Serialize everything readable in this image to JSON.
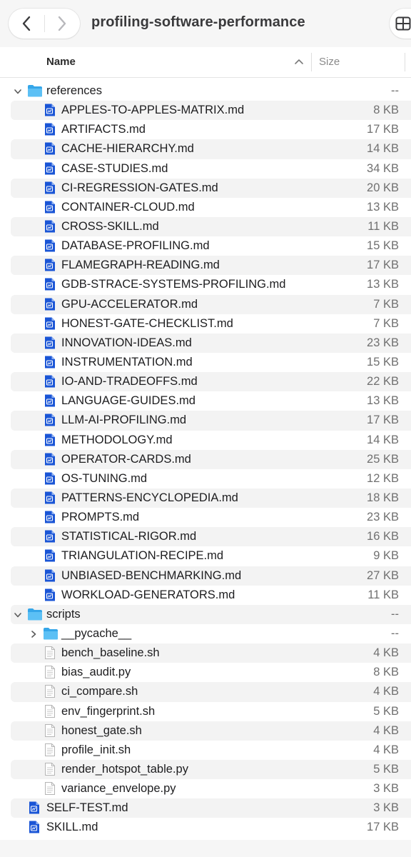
{
  "window": {
    "title": "profiling-software-performance"
  },
  "columns": {
    "name": "Name",
    "size": "Size"
  },
  "rows": [
    {
      "name": "references",
      "size": "--",
      "kind": "folder",
      "depth": 0,
      "expanded": true
    },
    {
      "name": "APPLES-TO-APPLES-MATRIX.md",
      "size": "8 KB",
      "kind": "md",
      "depth": 1
    },
    {
      "name": "ARTIFACTS.md",
      "size": "17 KB",
      "kind": "md",
      "depth": 1
    },
    {
      "name": "CACHE-HIERARCHY.md",
      "size": "14 KB",
      "kind": "md",
      "depth": 1
    },
    {
      "name": "CASE-STUDIES.md",
      "size": "34 KB",
      "kind": "md",
      "depth": 1
    },
    {
      "name": "CI-REGRESSION-GATES.md",
      "size": "20 KB",
      "kind": "md",
      "depth": 1
    },
    {
      "name": "CONTAINER-CLOUD.md",
      "size": "13 KB",
      "kind": "md",
      "depth": 1
    },
    {
      "name": "CROSS-SKILL.md",
      "size": "11 KB",
      "kind": "md",
      "depth": 1
    },
    {
      "name": "DATABASE-PROFILING.md",
      "size": "15 KB",
      "kind": "md",
      "depth": 1
    },
    {
      "name": "FLAMEGRAPH-READING.md",
      "size": "17 KB",
      "kind": "md",
      "depth": 1
    },
    {
      "name": "GDB-STRACE-SYSTEMS-PROFILING.md",
      "size": "13 KB",
      "kind": "md",
      "depth": 1
    },
    {
      "name": "GPU-ACCELERATOR.md",
      "size": "7 KB",
      "kind": "md",
      "depth": 1
    },
    {
      "name": "HONEST-GATE-CHECKLIST.md",
      "size": "7 KB",
      "kind": "md",
      "depth": 1
    },
    {
      "name": "INNOVATION-IDEAS.md",
      "size": "23 KB",
      "kind": "md",
      "depth": 1
    },
    {
      "name": "INSTRUMENTATION.md",
      "size": "15 KB",
      "kind": "md",
      "depth": 1
    },
    {
      "name": "IO-AND-TRADEOFFS.md",
      "size": "22 KB",
      "kind": "md",
      "depth": 1
    },
    {
      "name": "LANGUAGE-GUIDES.md",
      "size": "13 KB",
      "kind": "md",
      "depth": 1
    },
    {
      "name": "LLM-AI-PROFILING.md",
      "size": "17 KB",
      "kind": "md",
      "depth": 1
    },
    {
      "name": "METHODOLOGY.md",
      "size": "14 KB",
      "kind": "md",
      "depth": 1
    },
    {
      "name": "OPERATOR-CARDS.md",
      "size": "25 KB",
      "kind": "md",
      "depth": 1
    },
    {
      "name": "OS-TUNING.md",
      "size": "12 KB",
      "kind": "md",
      "depth": 1
    },
    {
      "name": "PATTERNS-ENCYCLOPEDIA.md",
      "size": "18 KB",
      "kind": "md",
      "depth": 1
    },
    {
      "name": "PROMPTS.md",
      "size": "23 KB",
      "kind": "md",
      "depth": 1
    },
    {
      "name": "STATISTICAL-RIGOR.md",
      "size": "16 KB",
      "kind": "md",
      "depth": 1
    },
    {
      "name": "TRIANGULATION-RECIPE.md",
      "size": "9 KB",
      "kind": "md",
      "depth": 1
    },
    {
      "name": "UNBIASED-BENCHMARKING.md",
      "size": "27 KB",
      "kind": "md",
      "depth": 1
    },
    {
      "name": "WORKLOAD-GENERATORS.md",
      "size": "11 KB",
      "kind": "md",
      "depth": 1
    },
    {
      "name": "scripts",
      "size": "--",
      "kind": "folder",
      "depth": 0,
      "expanded": true
    },
    {
      "name": "__pycache__",
      "size": "--",
      "kind": "folder",
      "depth": 1,
      "expanded": false
    },
    {
      "name": "bench_baseline.sh",
      "size": "4 KB",
      "kind": "script",
      "depth": 1
    },
    {
      "name": "bias_audit.py",
      "size": "8 KB",
      "kind": "script",
      "depth": 1
    },
    {
      "name": "ci_compare.sh",
      "size": "4 KB",
      "kind": "script",
      "depth": 1
    },
    {
      "name": "env_fingerprint.sh",
      "size": "5 KB",
      "kind": "script",
      "depth": 1
    },
    {
      "name": "honest_gate.sh",
      "size": "4 KB",
      "kind": "script",
      "depth": 1
    },
    {
      "name": "profile_init.sh",
      "size": "4 KB",
      "kind": "script",
      "depth": 1
    },
    {
      "name": "render_hotspot_table.py",
      "size": "5 KB",
      "kind": "script",
      "depth": 1
    },
    {
      "name": "variance_envelope.py",
      "size": "3 KB",
      "kind": "script",
      "depth": 1
    },
    {
      "name": "SELF-TEST.md",
      "size": "3 KB",
      "kind": "md",
      "depth": 0
    },
    {
      "name": "SKILL.md",
      "size": "17 KB",
      "kind": "md",
      "depth": 0
    }
  ],
  "colors": {
    "folder": "#35a6e9",
    "md_icon": "#1a55d6",
    "selection_stripe": "#f3f3f3"
  }
}
